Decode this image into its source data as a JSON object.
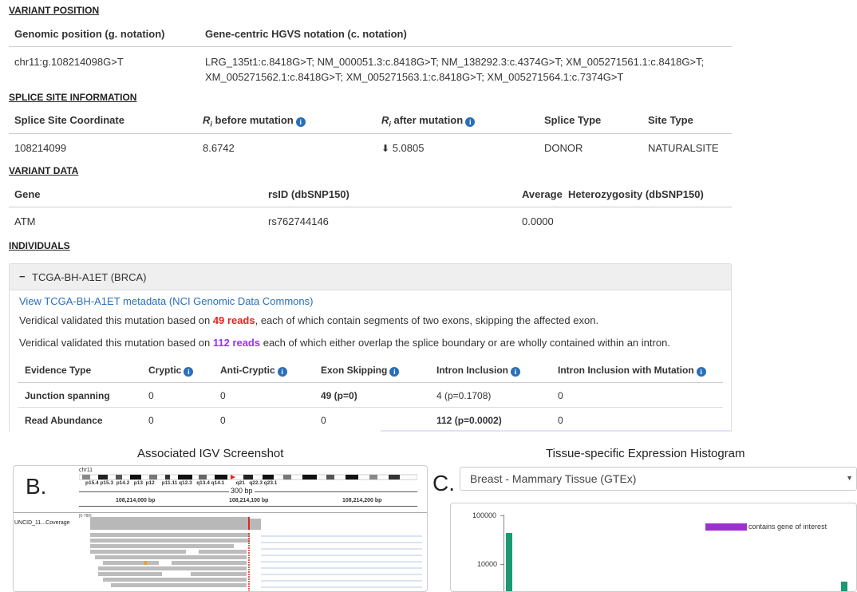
{
  "variant_position": {
    "heading": "VARIANT POSITION",
    "col1_header": "Genomic position (g. notation)",
    "col2_header": "Gene-centric HGVS notation (c. notation)",
    "genomic_position": "chr11:g.108214098G>T",
    "hgvs_line1": "LRG_135t1:c.8418G>T; NM_000051.3:c.8418G>T; NM_138292.3:c.4374G>T; XM_005271561.1:c.8418G>T;",
    "hgvs_line2": "XM_005271562.1:c.8418G>T; XM_005271563.1:c.8418G>T; XM_005271564.1:c.7374G>T"
  },
  "splice_site": {
    "heading": "SPLICE SITE INFORMATION",
    "headers": {
      "coordinate": "Splice Site Coordinate",
      "ri_before_sym": "R",
      "ri_before_sub": "i",
      "ri_before_rest": " before mutation",
      "ri_after_sym": "R",
      "ri_after_sub": "i",
      "ri_after_rest": " after mutation",
      "splice_type": "Splice Type",
      "site_type": "Site Type"
    },
    "coordinate": "108214099",
    "ri_before": "8.6742",
    "ri_after_arrow": "⬇",
    "ri_after": "5.0805",
    "splice_type": "DONOR",
    "site_type": "NATURALSITE"
  },
  "variant_data": {
    "heading": "VARIANT DATA",
    "headers": {
      "gene": "Gene",
      "rsid": "rsID (dbSNP150)",
      "het": "Average  Heterozygosity (dbSNP150)"
    },
    "gene": "ATM",
    "rsid": "rs762744146",
    "het": "0.0000"
  },
  "individuals": {
    "heading": "INDIVIDUALS",
    "panel_toggle": "−",
    "panel_title": "TCGA-BH-A1ET (BRCA)",
    "metadata_link": "View TCGA-BH-A1ET metadata (NCI Genomic Data Commons)",
    "sent1_pre": "Veridical validated this mutation based on ",
    "sent1_reads": "49 reads",
    "sent1_post": ", each of which contain segments of two exons, skipping the affected exon.",
    "sent2_pre": "Veridical validated this mutation based on ",
    "sent2_reads": "112 reads",
    "sent2_post": " each of which either overlap the splice boundary or are wholly contained within an intron.",
    "evidence_headers": [
      "Evidence Type",
      "Cryptic",
      "Anti-Cryptic",
      "Exon Skipping",
      "Intron Inclusion",
      "Intron Inclusion with Mutation"
    ],
    "rows": [
      {
        "type": "Junction spanning",
        "cryptic": "0",
        "anti": "0",
        "exon": "49 (p=0)",
        "intron": "4 (p=0.1708)",
        "intron_mut": "0"
      },
      {
        "type": "Read Abundance",
        "cryptic": "0",
        "anti": "0",
        "exon": "0",
        "intron": "112 (p=0.0002)",
        "intron_mut": "0"
      }
    ]
  },
  "igv": {
    "caption": "Associated IGV Screenshot",
    "panel_letter": "B.",
    "chrom": "chr11",
    "bands": [
      "p15.4",
      "p15.3",
      "p14.2",
      "p13",
      "p12",
      "p11.11",
      "q12.3",
      "q13.4",
      "q14.1",
      "q21",
      "q22.3",
      "q23.1"
    ],
    "span": "300 bp",
    "ticks": [
      "108,214,000 bp",
      "108,214,100 bp",
      "108,214,200 bp"
    ],
    "track_label": "UNCID_11...Coverage",
    "range_label": "[0-780]"
  },
  "histogram": {
    "caption": "Tissue-specific Expression Histogram",
    "panel_letter": "C.",
    "selected_tissue": "Breast - Mammary Tissue (GTEx)",
    "y_ticks": [
      "100000",
      "10000"
    ],
    "legend": "contains gene of interest",
    "colors": {
      "bar": "#1a9a74",
      "legend": "#9b30d0"
    }
  },
  "colors": {
    "link": "#2a6fb8",
    "red_highlight": "#e8231c",
    "purple_highlight": "#9b30ff"
  }
}
